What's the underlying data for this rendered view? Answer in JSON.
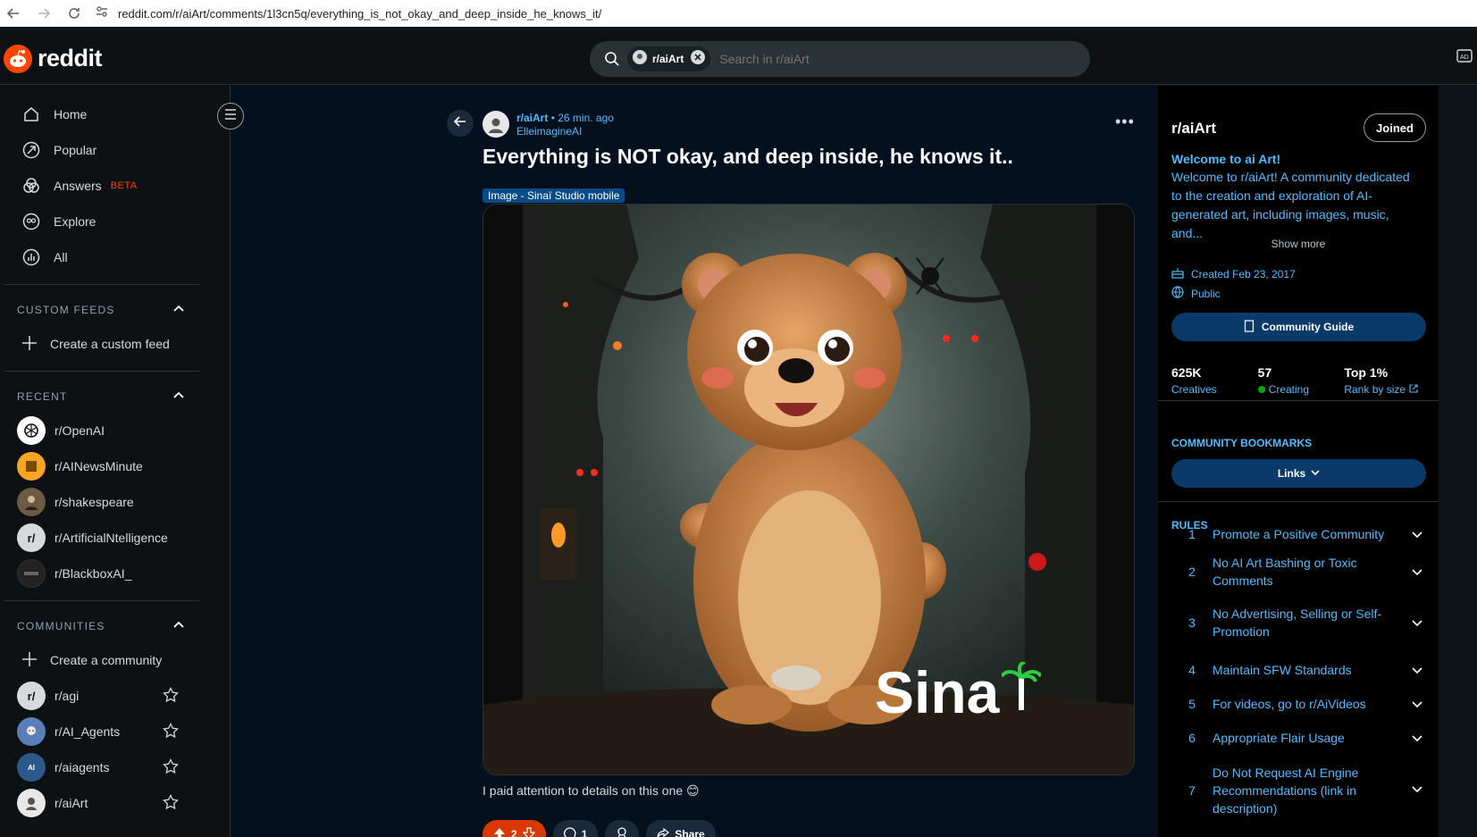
{
  "browser": {
    "url": "reddit.com/r/aiArt/comments/1l3cn5q/everything_is_not_okay_and_deep_inside_he_knows_it/"
  },
  "header": {
    "logo_text": "reddit",
    "search_chip": "r/aiArt",
    "search_placeholder": "Search in r/aiArt"
  },
  "sidebar": {
    "nav": [
      {
        "label": "Home",
        "icon": "home-icon"
      },
      {
        "label": "Popular",
        "icon": "popular-icon"
      },
      {
        "label": "Answers",
        "icon": "answers-icon",
        "badge": "BETA"
      },
      {
        "label": "Explore",
        "icon": "explore-icon"
      },
      {
        "label": "All",
        "icon": "all-icon"
      }
    ],
    "custom_feeds_heading": "CUSTOM FEEDS",
    "create_custom_feed": "Create a custom feed",
    "recent_heading": "RECENT",
    "recent": [
      {
        "name": "r/OpenAI",
        "color": "#ffffff"
      },
      {
        "name": "r/AINewsMinute",
        "color": "#f5a623"
      },
      {
        "name": "r/shakespeare",
        "color": "#6b5a44"
      },
      {
        "name": "r/ArtificialNtelligence",
        "color": "#d7dadc"
      },
      {
        "name": "r/BlackboxAI_",
        "color": "#222222"
      }
    ],
    "communities_heading": "COMMUNITIES",
    "create_community": "Create a community",
    "communities": [
      {
        "name": "r/agi",
        "color": "#d7dadc"
      },
      {
        "name": "r/AI_Agents",
        "color": "#5a7fb8"
      },
      {
        "name": "r/aiagents",
        "color": "#2b5a8a"
      },
      {
        "name": "r/aiArt",
        "color": "#e8e8e8"
      }
    ]
  },
  "post": {
    "subreddit": "r/aiArt",
    "time": "• 26 min. ago",
    "author": "ElleimagineAI",
    "title": "Everything is NOT okay, and deep inside, he knows it..",
    "flair": "Image - Sinaï Studio mobile",
    "watermark": "Sina",
    "body": "I paid attention to details on this one 😊",
    "votes": "2",
    "comments": "1",
    "share": "Share"
  },
  "community": {
    "name": "r/aiArt",
    "joined_label": "Joined",
    "welcome_heading": "Welcome to ai Art!",
    "welcome_text": "Welcome to r/aiArt! A community dedicated to the creation and exploration of AI-generated art, including images, music, and...",
    "show_more": "Show more",
    "created": "Created Feb 23, 2017",
    "visibility": "Public",
    "guide_label": "Community Guide",
    "stats": [
      {
        "value": "625K",
        "label": "Creatives"
      },
      {
        "value": "57",
        "label": "Creating"
      },
      {
        "value": "Top 1%",
        "label": "Rank by size"
      }
    ],
    "bookmarks_heading": "COMMUNITY BOOKMARKS",
    "links_label": "Links",
    "rules_heading": "RULES",
    "rules": [
      {
        "n": "1",
        "text": "Promote a Positive Community"
      },
      {
        "n": "2",
        "text": "No AI Art Bashing or Toxic Comments"
      },
      {
        "n": "3",
        "text": "No Advertising, Selling or Self-Promotion"
      },
      {
        "n": "4",
        "text": "Maintain SFW Standards"
      },
      {
        "n": "5",
        "text": "For videos, go to r/AiVideos"
      },
      {
        "n": "6",
        "text": "Appropriate Flair Usage"
      },
      {
        "n": "7",
        "text": "Do Not Request AI Engine Recommendations (link in description)"
      }
    ]
  },
  "colors": {
    "accent": "#4fbcff",
    "brand": "#ff4500",
    "vote": "#d93900"
  }
}
